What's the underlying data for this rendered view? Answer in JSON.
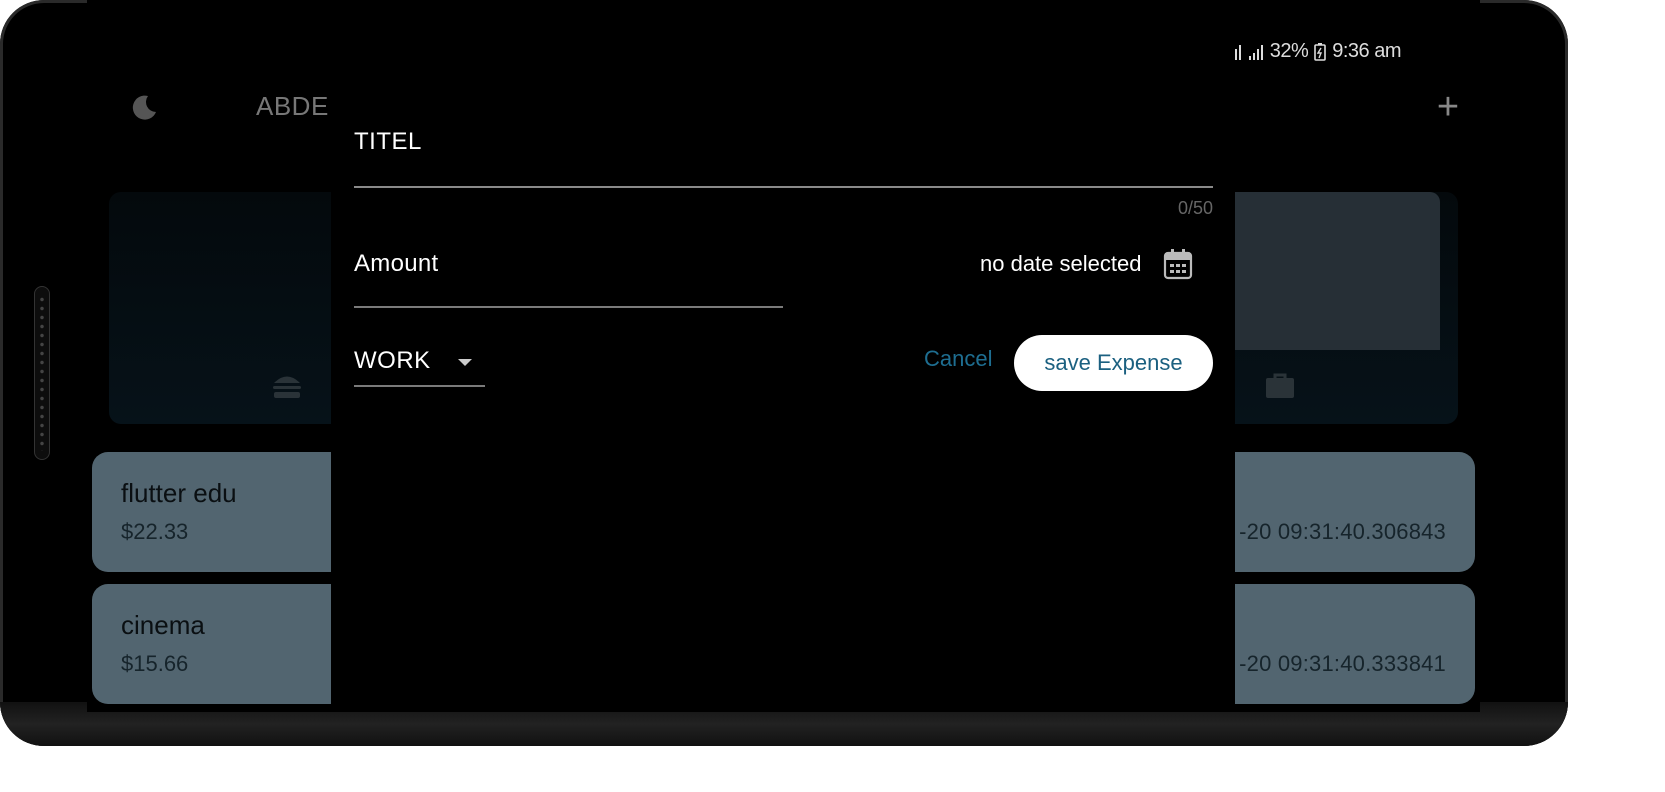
{
  "status_bar": {
    "battery": "32%",
    "time": "9:36 am",
    "icons": [
      "sim-card-icon",
      "signal-icon",
      "signal-icon",
      "battery-icon"
    ]
  },
  "app_bar": {
    "title": "ABDEI",
    "icons": [
      "moon-icon",
      "plus-icon"
    ]
  },
  "chart": {
    "category_icons": [
      "burger-icon",
      "briefcase-icon"
    ]
  },
  "expenses": [
    {
      "title": "flutter edu",
      "amount": "$22.33",
      "date": "-20 09:31:40.306843"
    },
    {
      "title": "cinema",
      "amount": "$15.66",
      "date": "-20 09:31:40.333841"
    }
  ],
  "modal": {
    "title_field": {
      "label": "TITEL",
      "counter": "0/50"
    },
    "amount_field": {
      "label": "Amount"
    },
    "date_text": "no date selected",
    "category": {
      "selected": "WORK"
    },
    "cancel_label": "Cancel",
    "save_label": "save Expense",
    "colors": {
      "accent": "#1e6e91",
      "save_text": "#1b6080"
    }
  }
}
